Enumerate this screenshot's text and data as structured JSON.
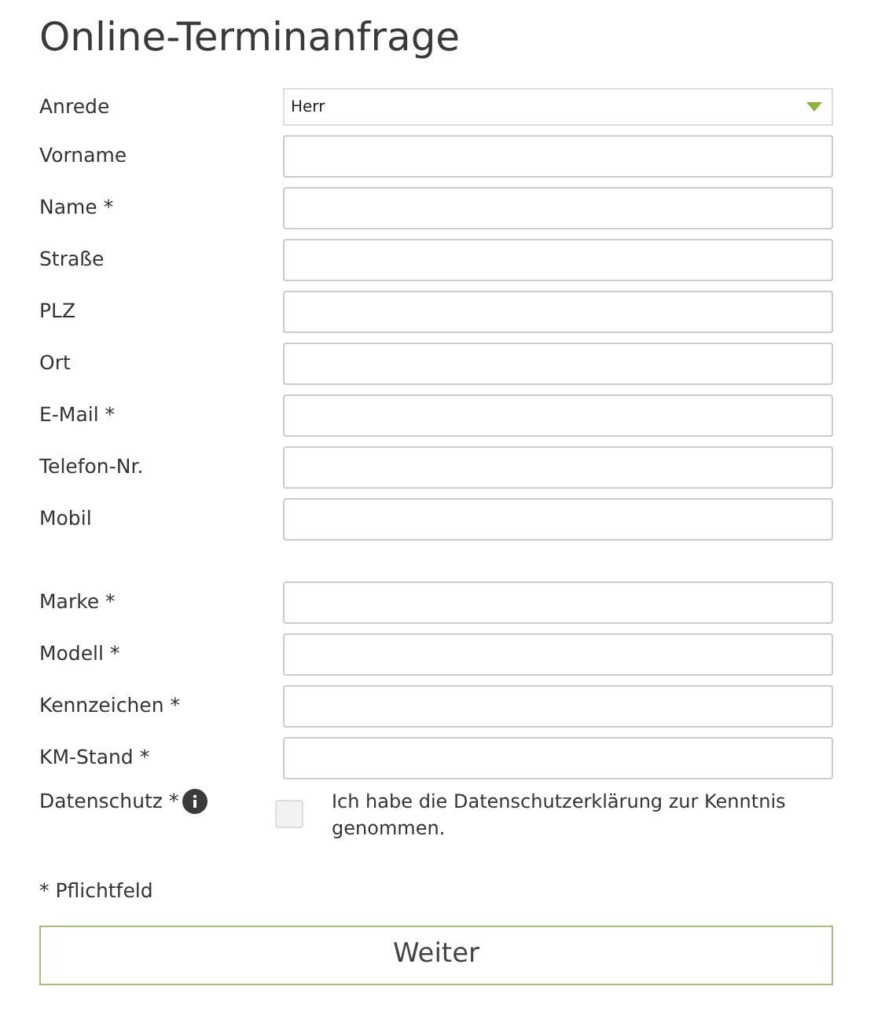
{
  "title": "Online-Terminanfrage",
  "personal_fields": [
    {
      "label": "Anrede",
      "kind": "select",
      "value": "Herr"
    },
    {
      "label": "Vorname",
      "kind": "text"
    },
    {
      "label": "Name *",
      "kind": "text"
    },
    {
      "label": "Straße",
      "kind": "text"
    },
    {
      "label": "PLZ",
      "kind": "text"
    },
    {
      "label": "Ort",
      "kind": "text"
    },
    {
      "label": "E-Mail *",
      "kind": "text"
    },
    {
      "label": "Telefon-Nr.",
      "kind": "text"
    },
    {
      "label": "Mobil",
      "kind": "text"
    }
  ],
  "vehicle_fields": [
    {
      "label": "Marke *",
      "kind": "text"
    },
    {
      "label": "Modell *",
      "kind": "text"
    },
    {
      "label": "Kennzeichen *",
      "kind": "text"
    },
    {
      "label": "KM-Stand *",
      "kind": "text"
    }
  ],
  "privacy": {
    "label": "Datenschutz *",
    "checked": false,
    "text": "Ich habe die Datenschutzerklärung zur Kenntnis genommen."
  },
  "required_note": "* Pflichtfeld",
  "submit": "Weiter"
}
